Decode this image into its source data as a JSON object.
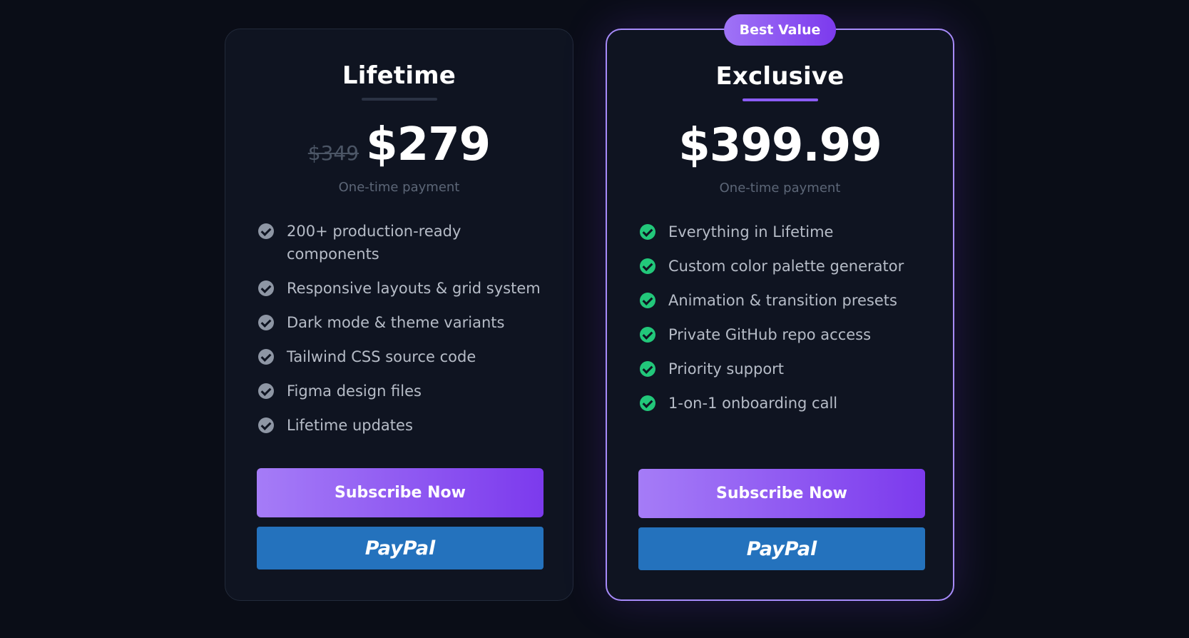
{
  "plans": [
    {
      "title": "Lifetime",
      "old_price": "$349",
      "price": "$279",
      "payment_note": "One-time payment",
      "features": [
        "200+ production-ready components",
        "Responsive layouts & grid system",
        "Dark mode & theme variants",
        "Tailwind CSS source code",
        "Figma design files",
        "Lifetime updates"
      ],
      "subscribe_label": "Subscribe Now",
      "paypal_label": "PayPal"
    },
    {
      "badge": "Best Value",
      "title": "Exclusive",
      "price": "$399.99",
      "payment_note": "One-time payment",
      "features": [
        "Everything in Lifetime",
        "Custom color palette generator",
        "Animation & transition presets",
        "Private GitHub repo access",
        "Priority support",
        "1-on-1 onboarding call"
      ],
      "subscribe_label": "Subscribe Now",
      "paypal_label": "PayPal"
    }
  ],
  "colors": {
    "background": "#0a0d17",
    "card": "#0f1421",
    "accent_purple": "#8b5cf6",
    "paypal_blue": "#2472bd",
    "check_gray": "#8e96a4",
    "check_green": "#22c77a"
  },
  "icons": {
    "feature_check": "check-circle-icon"
  }
}
